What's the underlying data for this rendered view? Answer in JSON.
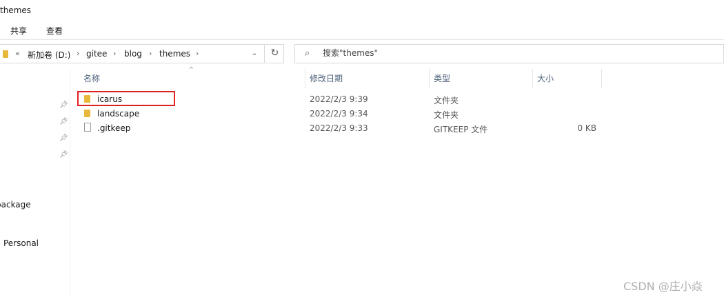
{
  "window": {
    "title": "themes"
  },
  "ribbon": {
    "tabs": [
      "共享",
      "查看"
    ]
  },
  "address": {
    "back_marker": "«",
    "crumbs": [
      "新加卷 (D:)",
      "gitee",
      "blog",
      "themes"
    ],
    "dropdown_glyph": "⌄",
    "refresh_glyph": "↻"
  },
  "search": {
    "placeholder": "搜索\"themes\"",
    "icon": "search-icon"
  },
  "nav": {
    "items": [
      "package",
      "Personal"
    ]
  },
  "columns": {
    "name": "名称",
    "date": "修改日期",
    "type": "类型",
    "size": "大小"
  },
  "files": [
    {
      "name": "icarus",
      "date": "2022/2/3 9:39",
      "type": "文件夹",
      "size": "",
      "icon": "folder-icon"
    },
    {
      "name": "landscape",
      "date": "2022/2/3 9:34",
      "type": "文件夹",
      "size": "",
      "icon": "folder-icon"
    },
    {
      "name": ".gitkeep",
      "date": "2022/2/3 9:33",
      "type": "GITKEEP 文件",
      "size": "0 KB",
      "icon": "file-icon"
    }
  ],
  "colors": {
    "highlight": "#e02020",
    "folder": "#e8b83b"
  },
  "watermark": "CSDN @庄小焱"
}
